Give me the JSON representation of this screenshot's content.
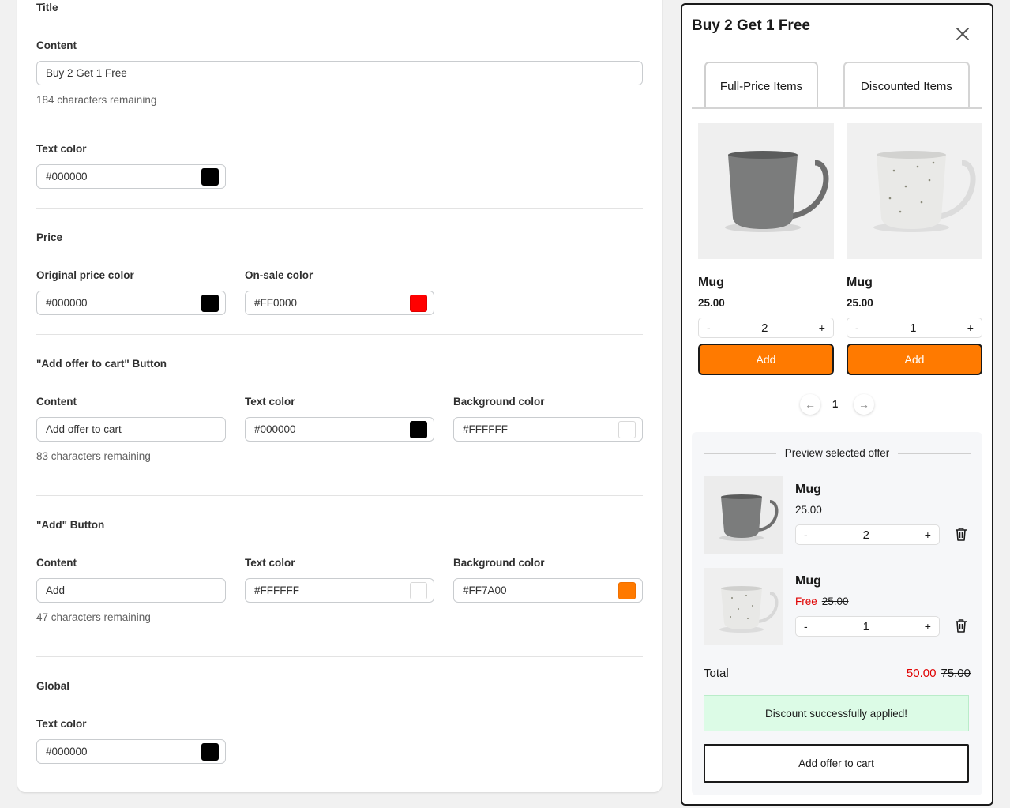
{
  "settings": {
    "title_section": {
      "heading": "Title",
      "content_label": "Content",
      "content_value": "Buy 2 Get 1 Free",
      "content_hint": "184 characters remaining",
      "text_color_label": "Text color",
      "text_color_value": "#000000"
    },
    "price_section": {
      "heading": "Price",
      "original_label": "Original price color",
      "original_value": "#000000",
      "sale_label": "On-sale color",
      "sale_value": "#FF0000"
    },
    "offer_button_section": {
      "heading": "\"Add offer to cart\" Button",
      "content_label": "Content",
      "content_value": "Add offer to cart",
      "content_hint": "83 characters remaining",
      "text_color_label": "Text color",
      "text_color_value": "#000000",
      "bg_color_label": "Background color",
      "bg_color_value": "#FFFFFF"
    },
    "add_button_section": {
      "heading": "\"Add\" Button",
      "content_label": "Content",
      "content_value": "Add",
      "content_hint": "47 characters remaining",
      "text_color_label": "Text color",
      "text_color_value": "#FFFFFF",
      "bg_color_label": "Background color",
      "bg_color_value": "#FF7A00"
    },
    "global_section": {
      "heading": "Global",
      "text_color_label": "Text color",
      "text_color_value": "#000000"
    }
  },
  "preview": {
    "title": "Buy 2 Get 1 Free",
    "tabs": [
      {
        "label": "Full-Price Items",
        "active": true
      },
      {
        "label": "Discounted Items",
        "active": false
      }
    ],
    "products": [
      {
        "name": "Mug",
        "price": "25.00",
        "qty": "2",
        "add_label": "Add",
        "minus": "-",
        "plus": "+",
        "image": "gray-mug"
      },
      {
        "name": "Mug",
        "price": "25.00",
        "qty": "1",
        "add_label": "Add",
        "minus": "-",
        "plus": "+",
        "image": "speckled-white-mug"
      }
    ],
    "pager": {
      "prev": "←",
      "page": "1",
      "next": "→"
    },
    "selected": {
      "heading": "Preview selected offer",
      "items": [
        {
          "name": "Mug",
          "price": "25.00",
          "qty": "2",
          "minus": "-",
          "plus": "+"
        },
        {
          "name": "Mug",
          "free_label": "Free",
          "price": "25.00",
          "qty": "1",
          "minus": "-",
          "plus": "+"
        }
      ],
      "total_label": "Total",
      "total_sale": "50.00",
      "total_original": "75.00",
      "success_message": "Discount successfully applied!",
      "offer_button": "Add offer to cart"
    },
    "colors": {
      "accent": "#FF7A00",
      "sale": "#FF0000",
      "success_bg": "#DCFBE6"
    }
  }
}
